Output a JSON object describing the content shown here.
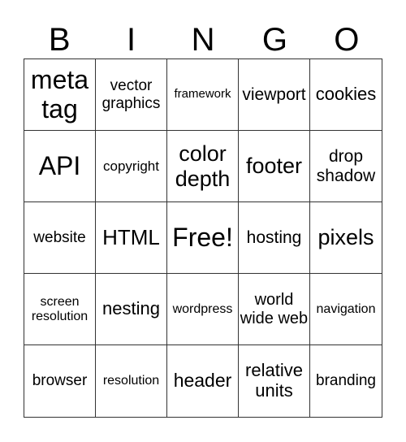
{
  "header": [
    "B",
    "I",
    "N",
    "G",
    "O"
  ],
  "cells": [
    "meta tag",
    "vector graphics",
    "framework",
    "viewport",
    "cookies",
    "API",
    "copyright",
    "color depth",
    "footer",
    "drop shadow",
    "website",
    "HTML",
    "Free!",
    "hosting",
    "pixels",
    "screen resolution",
    "nesting",
    "wordpress",
    "world wide web",
    "navigation",
    "browser",
    "resolution",
    "header",
    "relative units",
    "branding"
  ]
}
